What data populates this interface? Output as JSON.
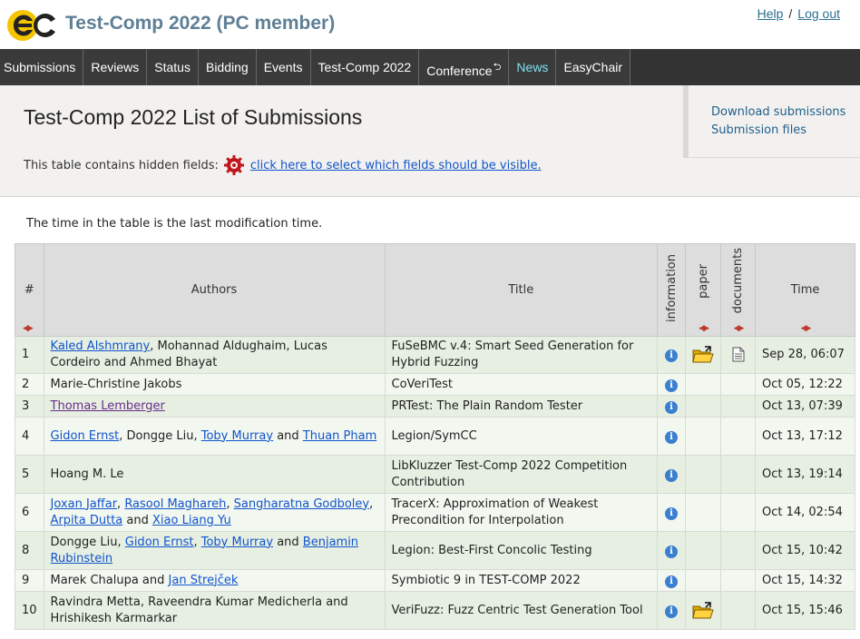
{
  "header": {
    "app_title": "Test-Comp 2022 (PC member)",
    "help": "Help",
    "separator": "/",
    "logout": "Log out",
    "logo_icon": "easychair-logo"
  },
  "nav": {
    "items": [
      {
        "label": "Submissions"
      },
      {
        "label": "Reviews"
      },
      {
        "label": "Status"
      },
      {
        "label": "Bidding"
      },
      {
        "label": "Events"
      },
      {
        "label": "Test-Comp 2022"
      },
      {
        "label": "Conference",
        "sup": "⮌"
      },
      {
        "label": "News",
        "active": true
      },
      {
        "label": "EasyChair"
      }
    ],
    "active_color": "#7fe0f0"
  },
  "panel": {
    "title": "Test-Comp 2022 List of Submissions",
    "hidden_note": "This table contains hidden fields:",
    "hidden_link": "click here to select which fields should be visible.",
    "side_links": [
      "Download submissions",
      "Submission files"
    ]
  },
  "time_note": "The time in the table is the last modification time.",
  "table": {
    "headers": {
      "num": "#",
      "authors": "Authors",
      "title": "Title",
      "information": "information",
      "paper": "paper",
      "documents": "documents",
      "time": "Time"
    },
    "sort_glyph": "◀▶",
    "rows": [
      {
        "num": "1",
        "authors": [
          {
            "text": "Kaled Alshmrany",
            "link": true
          },
          {
            "text": ", Mohannad Aldughaim, Lucas Cordeiro and Ahmed Bhayat"
          }
        ],
        "title": "FuSeBMC v.4: Smart Seed Generation for Hybrid Fuzzing",
        "paper": true,
        "documents": true,
        "time": "Sep 28, 06:07"
      },
      {
        "num": "2",
        "authors": [
          {
            "text": "Marie-Christine Jakobs"
          }
        ],
        "title": "CoVeriTest",
        "paper": false,
        "documents": false,
        "time": "Oct 05, 12:22"
      },
      {
        "num": "3",
        "authors": [
          {
            "text": "Thomas Lemberger",
            "link": true,
            "visited": true
          }
        ],
        "title": "PRTest: The Plain Random Tester",
        "paper": false,
        "documents": false,
        "time": "Oct 13, 07:39"
      },
      {
        "num": "4",
        "authors": [
          {
            "text": "Gidon Ernst",
            "link": true
          },
          {
            "text": ", Dongge Liu, "
          },
          {
            "text": "Toby Murray",
            "link": true
          },
          {
            "text": " and "
          },
          {
            "text": "Thuan Pham",
            "link": true
          }
        ],
        "title": "Legion/SymCC",
        "paper": false,
        "documents": false,
        "time": "Oct 13, 17:12"
      },
      {
        "num": "5",
        "authors": [
          {
            "text": "Hoang M. Le"
          }
        ],
        "title": "LibKluzzer Test-Comp 2022 Competition Contribution",
        "paper": false,
        "documents": false,
        "time": "Oct 13, 19:14"
      },
      {
        "num": "6",
        "authors": [
          {
            "text": "Joxan Jaffar",
            "link": true
          },
          {
            "text": ", "
          },
          {
            "text": "Rasool Maghareh",
            "link": true
          },
          {
            "text": ", "
          },
          {
            "text": "Sangharatna Godboley",
            "link": true
          },
          {
            "text": ", "
          },
          {
            "text": "Arpita Dutta",
            "link": true
          },
          {
            "text": " and "
          },
          {
            "text": "Xiao Liang Yu",
            "link": true
          }
        ],
        "title": "TracerX: Approximation of Weakest Precondition for Interpolation",
        "paper": false,
        "documents": false,
        "time": "Oct 14, 02:54"
      },
      {
        "num": "8",
        "authors": [
          {
            "text": "Dongge Liu, "
          },
          {
            "text": "Gidon Ernst",
            "link": true
          },
          {
            "text": ", "
          },
          {
            "text": "Toby Murray",
            "link": true
          },
          {
            "text": " and "
          },
          {
            "text": "Benjamin Rubinstein",
            "link": true
          }
        ],
        "title": "Legion: Best-First Concolic Testing",
        "paper": false,
        "documents": false,
        "time": "Oct 15, 10:42"
      },
      {
        "num": "9",
        "authors": [
          {
            "text": "Marek Chalupa and "
          },
          {
            "text": "Jan Strejček",
            "link": true
          }
        ],
        "title": "Symbiotic 9 in TEST-COMP 2022",
        "paper": false,
        "documents": false,
        "time": "Oct 15, 14:32"
      },
      {
        "num": "10",
        "authors": [
          {
            "text": "Ravindra Metta, Raveendra Kumar Medicherla and Hrishikesh Karmarkar"
          }
        ],
        "title": "VeriFuzz: Fuzz Centric Test Generation Tool",
        "paper": true,
        "documents": false,
        "time": "Oct 15, 15:46"
      }
    ]
  },
  "icons": {
    "info": "info-icon",
    "paper": "folder-icon",
    "documents": "document-icon",
    "gear": "gear-icon"
  }
}
